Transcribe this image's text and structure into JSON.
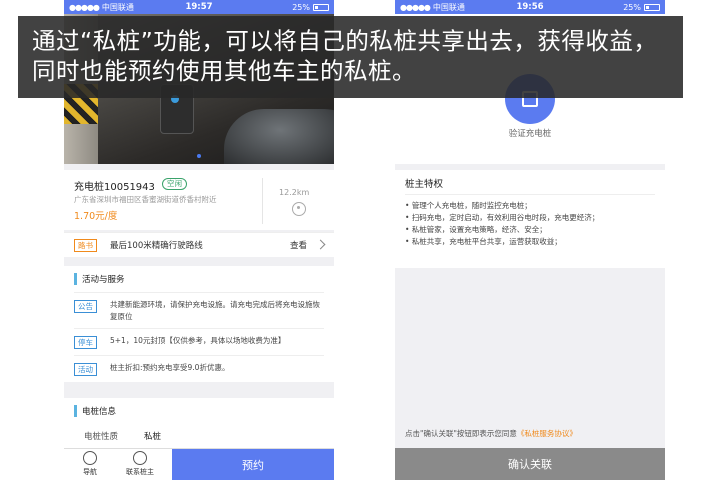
{
  "left_phone": {
    "status": {
      "carrier": "中国联通",
      "time": "19:57",
      "battery": "25%"
    },
    "station": {
      "name": "充电桩10051943",
      "status_badge": "空闲",
      "address": "广东省深圳市福田区香蜜湖街道侨香村附近",
      "price": "1.70元/度",
      "distance": "12.2km"
    },
    "route": {
      "tag": "路书",
      "text": "最后100米精确行驶路线",
      "more": "查看"
    },
    "services": {
      "title": "活动与服务",
      "items": [
        {
          "tag": "公告",
          "text": "共建新能源环境，请保护充电设施。请充电完成后将充电设施恢复原位"
        },
        {
          "tag": "停车",
          "text": "5+1，10元封顶【仅供参考，具体以场地收费为准】"
        },
        {
          "tag": "活动",
          "text": "桩主折扣:预约充电享受9.0折优惠。"
        }
      ]
    },
    "pile_info": {
      "title": "电桩信息",
      "label": "电桩性质",
      "value": "私桩"
    },
    "bottom": {
      "nav_label": "导航",
      "contact_label": "联系桩主",
      "reserve_label": "预约"
    }
  },
  "right_phone": {
    "status": {
      "carrier": "中国联通",
      "time": "19:56",
      "battery": "25%"
    },
    "verify_label": "验证充电桩",
    "privilege": {
      "title": "桩主特权",
      "items": [
        "管理个人充电桩，随时监控充电桩；",
        "扫码充电，定时启动，有效利用谷电时段，充电更经济；",
        "私桩管家，设置充电策略，经济、安全；",
        "私桩共享，充电桩平台共享，运营获取收益；"
      ]
    },
    "agreement": {
      "prefix": "点击\"确认关联\"按钮即表示您同意",
      "link": "《私桩服务协议》"
    },
    "confirm_label": "确认关联"
  },
  "caption": "通过“私桩”功能，可以将自己的私桩共享出去，获得收益，同时也能预约使用其他车主的私桩。",
  "colors": {
    "accent": "#5b7bf0",
    "orange": "#f08a1c",
    "free_green": "#3aa36b",
    "tag_blue": "#3a8fd6"
  }
}
